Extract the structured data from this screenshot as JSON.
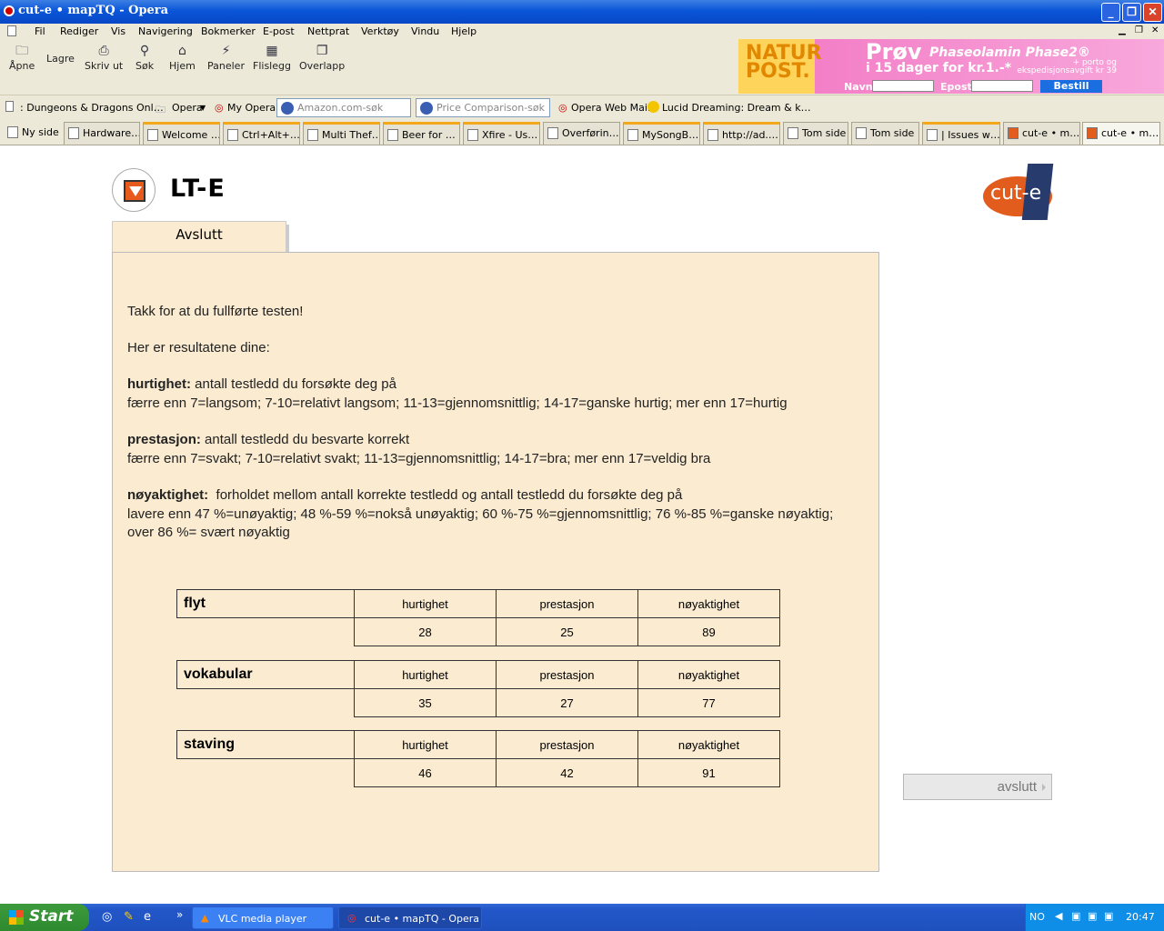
{
  "window": {
    "title": "cut-e • mapTQ - Opera",
    "buttons": [
      "_",
      "❐",
      "✕"
    ]
  },
  "menu": [
    "Fil",
    "Rediger",
    "Vis",
    "Navigering",
    "Bokmerker",
    "E-post",
    "Nettprat",
    "Verktøy",
    "Vindu",
    "Hjelp"
  ],
  "toolbar": [
    {
      "label": "Åpne",
      "icon": "folder-icon"
    },
    {
      "label": "Lagre",
      "icon": "save-icon"
    },
    {
      "label": "Skriv ut",
      "icon": "print-icon"
    },
    {
      "label": "Søk",
      "icon": "search-icon"
    },
    {
      "label": "Hjem",
      "icon": "home-icon"
    },
    {
      "label": "Paneler",
      "icon": "panels-icon"
    },
    {
      "label": "Flislegg",
      "icon": "tile-icon"
    },
    {
      "label": "Overlapp",
      "icon": "cascade-icon"
    }
  ],
  "ad": {
    "brand": "NATUR POST.",
    "headline": "Prøv",
    "product": "Phaseolamin Phase2®",
    "offer": "i 15 dager for kr.1.-*",
    "note": "+ porto og ekspedisjonsavgift kr 39",
    "name_label": "Navn:",
    "email_label": "Epost:",
    "button": "Bestill"
  },
  "bookmarks": [
    ": Dungeons & Dragons Onl…",
    "Opera",
    "My Opera",
    "Opera Web Mail",
    "Lucid Dreaming: Dream & k…"
  ],
  "search": {
    "amazon_placeholder": "Amazon.com-søk",
    "price_placeholder": "Price Comparison-søk"
  },
  "tabs": [
    "Ny side",
    "Hardware…",
    "Welcome …",
    "Ctrl+Alt+…",
    "Multi Thef…",
    "Beer for …",
    "Xfire - Us…",
    "Overførin…",
    "MySongB…",
    "http://ad.…",
    "Tom side",
    "Tom side",
    "| Issues w…",
    "cut-e • m…",
    "cut-e • m…"
  ],
  "page": {
    "app_title": "LT-E",
    "brand_logo": "cut-e",
    "tab_label": "Avslutt",
    "thanks": "Takk for at du fullførte testen!",
    "intro": "Her er resultatene dine:",
    "def1_term": "hurtighet:",
    "def1_desc": " antall testledd du forsøkte deg på",
    "def1_scale": "færre enn 7=langsom; 7-10=relativt langsom; 11-13=gjennomsnittlig; 14-17=ganske hurtig; mer enn 17=hurtig",
    "def2_term": "prestasjon:",
    "def2_desc": " antall testledd du besvarte korrekt",
    "def2_scale": "færre enn 7=svakt; 7-10=relativt svakt; 11-13=gjennomsnittlig; 14-17=bra; mer enn 17=veldig bra",
    "def3_term": "nøyaktighet:",
    "def3_desc": "  forholdet mellom antall korrekte testledd og antall testledd du forsøkte deg på",
    "def3_scale1": "lavere enn 47 %=unøyaktig; 48 %-59 %=nokså unøyaktig; 60 %-75 %=gjennomsnittlig; 76 %-85 %=ganske nøyaktig;",
    "def3_scale2": "over 86 %= svært nøyaktig",
    "results": [
      {
        "name": "flyt",
        "h1": "hurtighet",
        "h2": "prestasjon",
        "h3": "nøyaktighet",
        "v1": "28",
        "v2": "25",
        "v3": "89"
      },
      {
        "name": "vokabular",
        "h1": "hurtighet",
        "h2": "prestasjon",
        "h3": "nøyaktighet",
        "v1": "35",
        "v2": "27",
        "v3": "77"
      },
      {
        "name": "staving",
        "h1": "hurtighet",
        "h2": "prestasjon",
        "h3": "nøyaktighet",
        "v1": "46",
        "v2": "42",
        "v3": "91"
      }
    ],
    "exit_button": "avslutt"
  },
  "taskbar": {
    "start": "Start",
    "tasks": [
      "VLC media player",
      "cut-e • mapTQ - Opera"
    ],
    "lang": "NO",
    "clock": "20:47"
  }
}
